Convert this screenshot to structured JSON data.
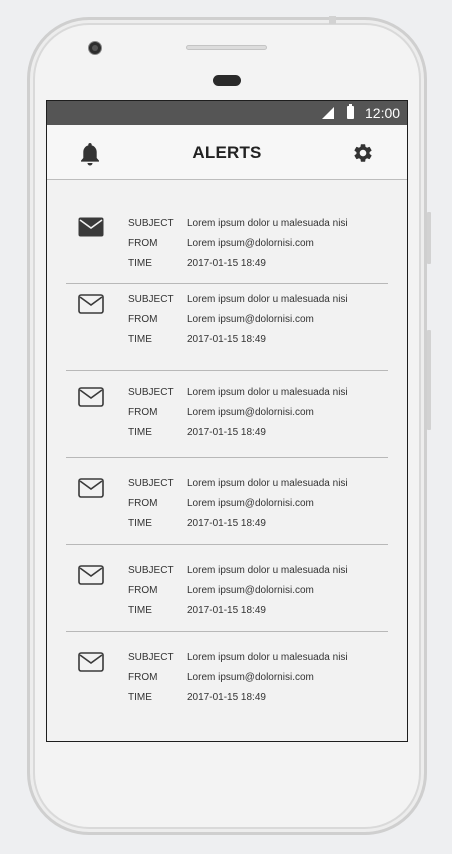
{
  "status_bar": {
    "time": "12:00"
  },
  "app_bar": {
    "title": "ALERTS",
    "left_icon": "bell-icon",
    "right_icon": "gear-icon"
  },
  "alerts": [
    {
      "subject_label": "SUBJECT",
      "subject": "Lorem ipsum dolor u malesuada nisi",
      "from_label": "FROM",
      "from": "Lorem ipsum@dolornisi.com",
      "time_label": "TIME",
      "time": "2017-01-15 18:49",
      "icon": "envelope-filled-icon"
    },
    {
      "subject_label": "SUBJECT",
      "subject": "Lorem ipsum dolor u malesuada nisi",
      "from_label": "FROM",
      "from": "Lorem ipsum@dolornisi.com",
      "time_label": "TIME",
      "time": "2017-01-15 18:49",
      "icon": "envelope-outline-icon"
    },
    {
      "subject_label": "SUBJECT",
      "subject": "Lorem ipsum dolor u malesuada nisi",
      "from_label": "FROM",
      "from": "Lorem ipsum@dolornisi.com",
      "time_label": "TIME",
      "time": "2017-01-15 18:49",
      "icon": "envelope-outline-icon"
    },
    {
      "subject_label": "SUBJECT",
      "subject": "Lorem ipsum dolor u malesuada nisi",
      "from_label": "FROM",
      "from": "Lorem ipsum@dolornisi.com",
      "time_label": "TIME",
      "time": "2017-01-15 18:49",
      "icon": "envelope-outline-icon"
    },
    {
      "subject_label": "SUBJECT",
      "subject": "Lorem ipsum dolor u malesuada nisi",
      "from_label": "FROM",
      "from": "Lorem ipsum@dolornisi.com",
      "time_label": "TIME",
      "time": "2017-01-15 18:49",
      "icon": "envelope-outline-icon"
    },
    {
      "subject_label": "SUBJECT",
      "subject": "Lorem ipsum dolor u malesuada nisi",
      "from_label": "FROM",
      "from": "Lorem ipsum@dolornisi.com",
      "time_label": "TIME",
      "time": "2017-01-15 18:49",
      "icon": "envelope-outline-icon"
    }
  ],
  "colors": {
    "status_bar_bg": "#555555",
    "app_bar_bg": "#f7f7f7",
    "screen_bg": "#f2f2f2",
    "icon": "#333333"
  }
}
